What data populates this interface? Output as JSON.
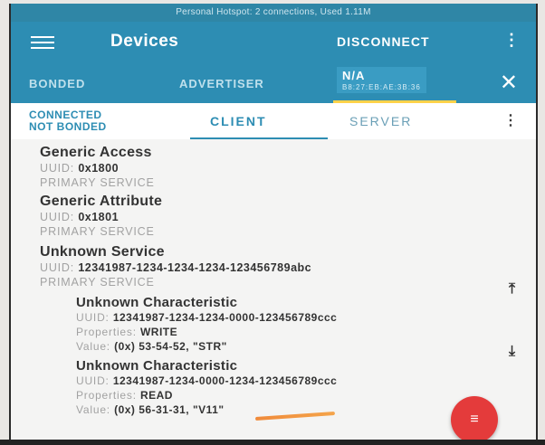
{
  "status_bar": {
    "text": "Personal Hotspot: 2 connections, Used 1.11M"
  },
  "toolbar": {
    "title": "Devices",
    "disconnect_label": "DISCONNECT",
    "more_icon": "more-vert-icon"
  },
  "device_tabs": {
    "bonded": "BONDED",
    "advertiser": "ADVERTISER",
    "device_name": "N/A",
    "device_address": "B8:27:EB:AE:3B:36"
  },
  "sub_tabs": {
    "state_line1": "CONNECTED",
    "state_line2": "NOT BONDED",
    "client": "CLIENT",
    "server": "SERVER"
  },
  "services": [
    {
      "name": "Generic Access",
      "uuid_label": "UUID:",
      "uuid": "0x1800",
      "type": "PRIMARY SERVICE"
    },
    {
      "name": "Generic Attribute",
      "uuid_label": "UUID:",
      "uuid": "0x1801",
      "type": "PRIMARY SERVICE"
    },
    {
      "name": "Unknown Service",
      "uuid_label": "UUID:",
      "uuid": "12341987-1234-1234-1234-123456789abc",
      "type": "PRIMARY SERVICE"
    }
  ],
  "characteristics": [
    {
      "name": "Unknown Characteristic",
      "uuid_label": "UUID:",
      "uuid": "12341987-1234-1234-0000-123456789ccc",
      "properties_label": "Properties:",
      "properties": "WRITE",
      "value_label": "Value:",
      "value": "(0x) 53-54-52, \"STR\""
    },
    {
      "name": "Unknown Characteristic",
      "uuid_label": "UUID:",
      "uuid": "12341987-1234-0000-1234-123456789ccc",
      "properties_label": "Properties:",
      "properties": "READ",
      "value_label": "Value:",
      "value": "(0x) 56-31-31, \"V11\""
    }
  ],
  "icons": {
    "upload": "upload-icon",
    "download": "download-icon",
    "close": "close-icon",
    "fab": "log-icon"
  },
  "colors": {
    "primary": "#2d8db3",
    "accent_indicator": "#ffd24a",
    "fab": "#e43b3b"
  }
}
